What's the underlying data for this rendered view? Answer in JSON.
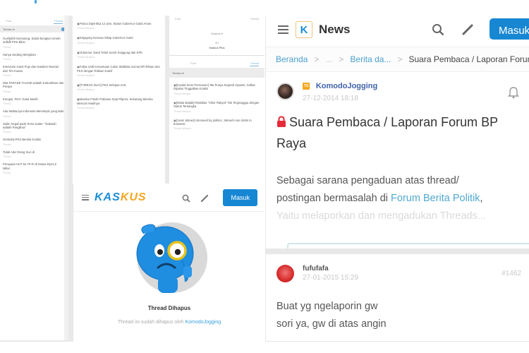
{
  "collage": {
    "left_column": {
      "tabs": [
        "Post",
        "Thread"
      ],
      "filter_label": "Terbaru ▾",
      "items": [
        {
          "title": "Gusfadhli Semarang, Saldo Bongkar Umrah Zulkifli PKS Bilon",
          "meta": "Thread"
        },
        {
          "title": "Hanya Sedang Menjalani",
          "meta": "Thread"
        },
        {
          "title": "Intervensi Gatot Pujo dan Nasdem Mundur dari Tim Kuasa",
          "meta": "Thread"
        },
        {
          "title": "Niat PARADE TAUHID adalah Kebodohan dan Penipu",
          "meta": "Thread"
        },
        {
          "title": "Korupsi, PKS: Gatot Masih",
          "meta": "Thread"
        },
        {
          "title": "Ada Waktunya Indonesia Memimpin yang Baik",
          "meta": "Thread"
        },
        {
          "title": "Salim Segaf pada Temu Kader: \"Dakwah adalah Panglima\"",
          "meta": "Thread"
        },
        {
          "title": "Gerindra-PKS Bentuk Koalisi",
          "meta": "Thread"
        },
        {
          "title": "Tidak Ada Orang Suci di",
          "meta": "Thread"
        },
        {
          "title": "Perayaan HUT ke-70 RI di Istana Rp11,5 Miliar",
          "meta": "Thread"
        }
      ]
    },
    "middle_column": {
      "items": [
        {
          "title": "Pasca Diperiksa 12 Jam, Status Gubernur Gatot Aman",
          "meta": "Thread dihapus"
        },
        {
          "title": "Kejagung Kecewa Sikap Gubernur Gatot",
          "meta": "Thread dihapus"
        },
        {
          "title": "Gubernur Gatot Telah Suruh Kejagung dan KPK",
          "meta": "Thread dihapus"
        },
        {
          "title": "Fakta Unik! Kesamaan Calon Walikota Gumai DR Ikhsan dan PKS dengan Ridwan Kamil",
          "meta": "Thread dihapus"
        },
        {
          "title": "[THREAD SUCI] PKS Selepas Anis",
          "meta": "Thread dihapus"
        },
        {
          "title": "Mereka Fitnah Prabowo Saat Pilpres, Sekarang Mereka Mencari Hasilnya",
          "meta": "Thread dihapus"
        }
      ]
    },
    "right_column": {
      "tabs_top": [
        "Post",
        "Thread"
      ],
      "profile_line": "Kaskus ▾",
      "profile_stat": "20",
      "profile_name": "Kaskus Plus",
      "tabs": [
        "Post",
        "Thread"
      ],
      "filter_label": "Terbaru ▾",
      "items": [
        {
          "title": "[Koalisi Semi Permanen] Tak Punya Sejarah Oposisi, Golkar Dipakai Tinggalkan Koalisi",
          "meta": "Thread dihapus"
        },
        {
          "title": "[Muka Badak] Redaktur \"Obor Rakyat\" Tak Tergangggu dengan Status Tersangka",
          "meta": "Thread dihapus"
        },
        {
          "title": "[Anak Jokowi] Unmoved by politics, Jokowi's son sticks to business",
          "meta": "Thread dihapus"
        }
      ]
    },
    "deleted_panel": {
      "logo_part1": "KAS",
      "logo_part2": "KUS",
      "login_label": "Masuk",
      "title": "Thread Dihapus",
      "subtitle_prefix": "Thread ini sudah dihapus oleh",
      "subtitle_user": "KomodoJogging"
    }
  },
  "news": {
    "header": {
      "logo_glyph": "K",
      "title": "News",
      "login_label": "Masuk"
    },
    "breadcrumb": [
      {
        "label": "Beranda",
        "link": true
      },
      {
        "label": "...",
        "link": false
      },
      {
        "label": "Berita da...",
        "link": true
      },
      {
        "label": "Suara Pembaca / Laporan Forum BP Raya",
        "link": false
      }
    ],
    "post": {
      "badge": "TS",
      "author": "KomodoJogging",
      "date": "27-12-2014 18:18",
      "title": "Suara Pembaca / Laporan Forum BP Raya",
      "body_line1": "Sebagai sarana pengaduan atas thread/",
      "body_line2_prefix": "postingan bermasalah di ",
      "body_link": "Forum Berita Politik",
      "body_line2_suffix": ",",
      "body_line3": "Yaitu melaporkan dan mengadukan Threads..."
    },
    "reply": {
      "author": "fufufafa",
      "date": "27-01-2015 15:29",
      "post_number": "#1462",
      "line1": "Buat yg ngelaporin gw",
      "line2": "sori ya, gw di atas angin"
    }
  }
}
